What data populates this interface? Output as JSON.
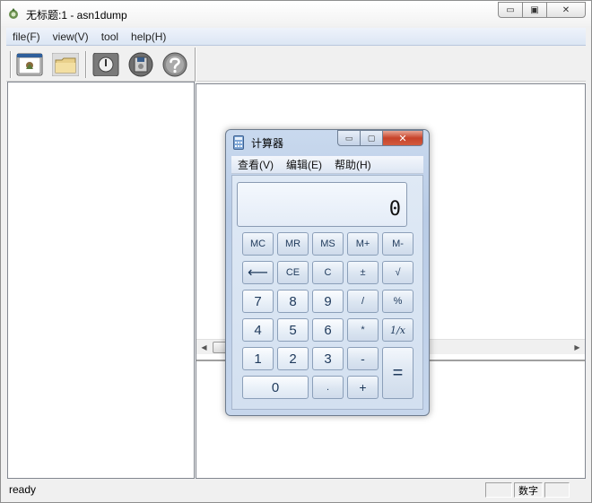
{
  "window": {
    "title": "无标题:1 - asn1dump",
    "min_glyph": "▭",
    "max_glyph": "▣",
    "close_glyph": "✕"
  },
  "menu": [
    {
      "label": "file(F)"
    },
    {
      "label": "view(V)"
    },
    {
      "label": "tool"
    },
    {
      "label": "help(H)"
    }
  ],
  "toolbar": {
    "icons": [
      "window-icon",
      "folder-icon",
      "power-icon",
      "disk-icon",
      "help-icon"
    ]
  },
  "status": {
    "text": "ready",
    "numlock": "数字"
  },
  "calculator": {
    "title": "计算器",
    "min_glyph": "▭",
    "max_glyph": "▢",
    "close_glyph": "✕",
    "menu": [
      "查看(V)",
      "编辑(E)",
      "帮助(H)"
    ],
    "display": "0",
    "keys": {
      "mc": "MC",
      "mr": "MR",
      "ms": "MS",
      "mplus": "M+",
      "mminus": "M-",
      "back": "⟵",
      "ce": "CE",
      "c": "C",
      "sign": "±",
      "sqrt": "√",
      "n7": "7",
      "n8": "8",
      "n9": "9",
      "div": "/",
      "pct": "%",
      "n4": "4",
      "n5": "5",
      "n6": "6",
      "mul": "*",
      "recip": "1/x",
      "n1": "1",
      "n2": "2",
      "n3": "3",
      "sub": "-",
      "eq": "=",
      "n0": "0",
      "dot": ".",
      "add": "+"
    }
  },
  "colors": {
    "menubar": "#dce6f4",
    "calc_frame": "#b9cce6",
    "close_red": "#c7432a",
    "key_text": "#1e395b"
  }
}
